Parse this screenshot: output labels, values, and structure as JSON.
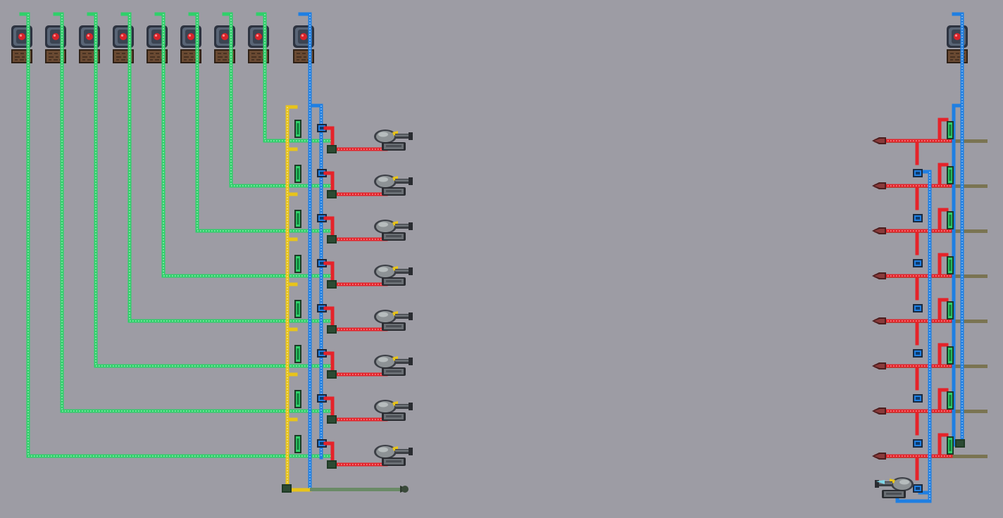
{
  "scene": {
    "background": "#9d9ca4",
    "wire_colors": {
      "red": "#e5232a",
      "blue": "#1f7fe2",
      "green": "#2fd06a",
      "yellow": "#e8c41a"
    },
    "left_array": {
      "lever_count": 9,
      "active_lever": 9,
      "dart_trap_count": 8,
      "final_trap_count": 1
    },
    "right_array": {
      "lever_count": 1,
      "spear_trap_count": 8,
      "dart_trap_count": 1
    },
    "icons": [
      "lever-icon",
      "wooden-box-icon",
      "dart-trap-icon",
      "spear-trap-icon",
      "logic-gate-icon",
      "junction-box-icon"
    ]
  }
}
